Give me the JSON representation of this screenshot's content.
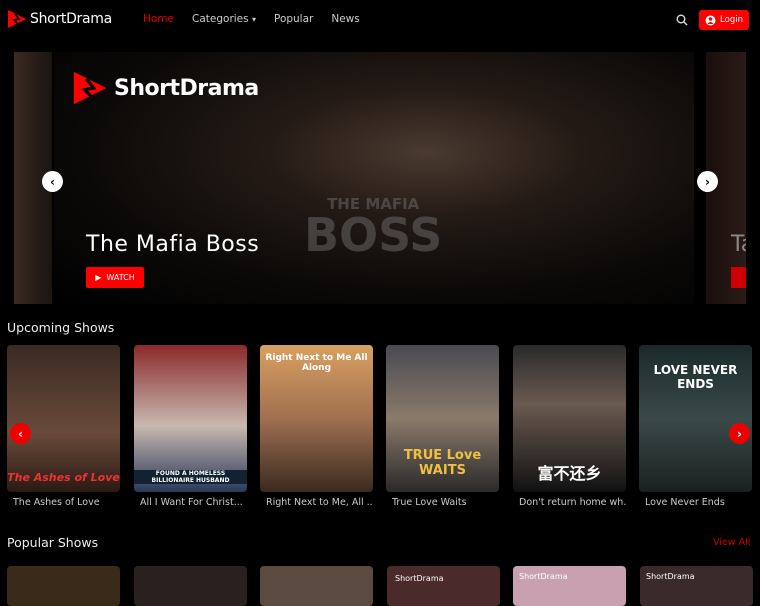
{
  "nav": {
    "brand": "ShortDrama",
    "items": [
      {
        "label": "Home",
        "active": true
      },
      {
        "label": "Categories"
      },
      {
        "label": "Popular"
      },
      {
        "label": "News"
      }
    ],
    "login": "Login"
  },
  "hero": {
    "brand": "ShortDrama",
    "watermark_top": "THE MAFIA",
    "watermark_bottom": "BOSS",
    "title": "The Mafia Boss",
    "watch": "WATCH",
    "next_peek": "Ta"
  },
  "upcoming": {
    "title": "Upcoming Shows",
    "items": [
      {
        "title": "The Ashes of Love",
        "poster_text": "The Ashes of Love"
      },
      {
        "title": "All I Want For Christ...",
        "poster_text": "FOUND A HOMELESS BILLIONAIRE HUSBAND"
      },
      {
        "title": "Right Next to Me, All ...",
        "poster_text": "Right Next to Me All Along"
      },
      {
        "title": "True Love Waits",
        "poster_text": "TRUE Love WAITS"
      },
      {
        "title": "Don't return home wh...",
        "poster_text": "富不还乡"
      },
      {
        "title": "Love Never Ends",
        "poster_text": "LOVE NEVER ENDS"
      }
    ]
  },
  "popular": {
    "title": "Popular Shows",
    "view_all": "View All",
    "brand": "ShortDrama"
  },
  "colors": {
    "accent": "#ff0000",
    "bg": "#000000"
  }
}
